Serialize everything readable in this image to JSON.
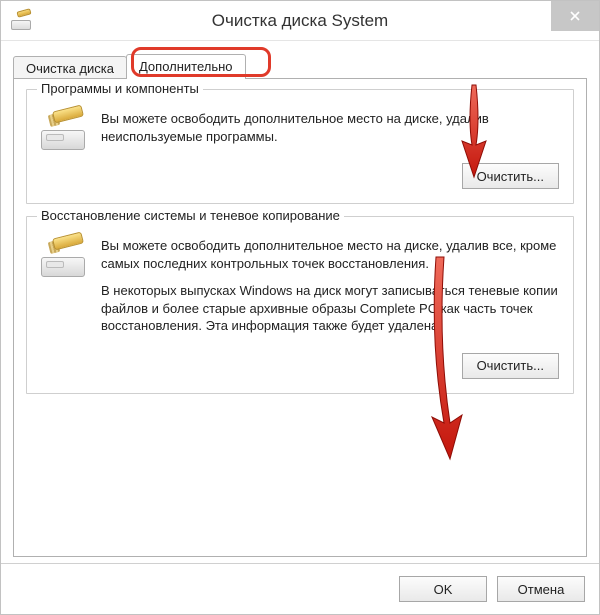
{
  "titlebar": {
    "title": "Очистка диска System"
  },
  "tabs": {
    "disk_cleanup": "Очистка диска",
    "advanced": "Дополнительно"
  },
  "groups": {
    "programs": {
      "legend": "Программы и компоненты",
      "text": "Вы можете освободить дополнительное место на диске, удалив неиспользуемые программы.",
      "button": "Очистить..."
    },
    "restore": {
      "legend": "Восстановление системы и теневое копирование",
      "text1": "Вы можете освободить дополнительное место на диске, удалив все, кроме самых последних контрольных точек восстановления.",
      "text2": "В некоторых выпусках Windows на диск могут записываться теневые копии файлов и более старые архивные образы Complete PC как часть точек восстановления. Эта информация также будет удалена.",
      "button": "Очистить..."
    }
  },
  "footer": {
    "ok": "OK",
    "cancel": "Отмена"
  },
  "annotation": {
    "highlight_color": "#e03a2a",
    "arrow_color": "#d8231b"
  }
}
